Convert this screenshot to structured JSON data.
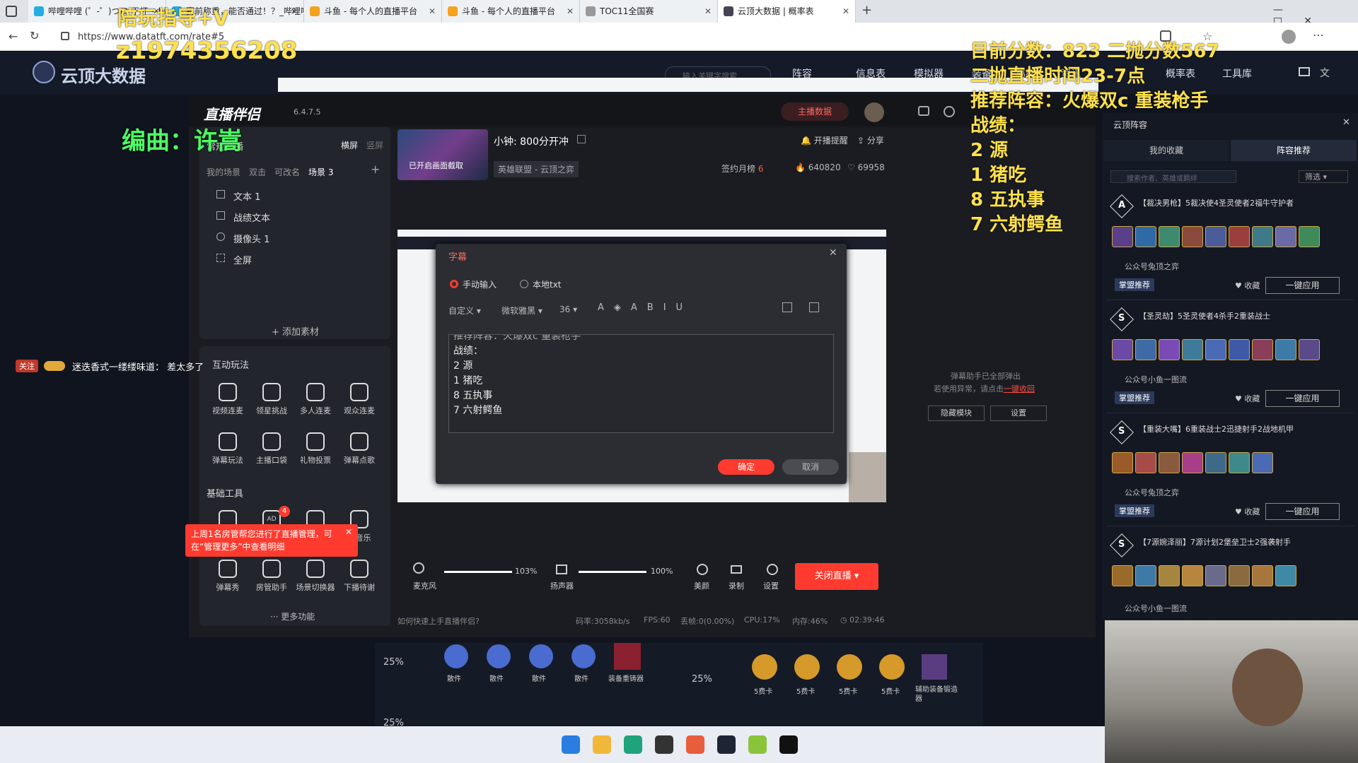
{
  "browser": {
    "tabs": [
      {
        "label": "哔哩哔哩 (゜-゜)つロ 干杯~-bili"
      },
      {
        "label": "赛前称重，能否通过！？_哔哩哔哩"
      },
      {
        "label": "斗鱼 - 每个人的直播平台"
      },
      {
        "label": "斗鱼 - 每个人的直播平台"
      },
      {
        "label": "TOC11全国赛"
      },
      {
        "label": "云顶大数据 | 概率表"
      }
    ],
    "url": "https://www.datatft.com/rate#5"
  },
  "site": {
    "logo": "云顶大数据",
    "search_placeholder": "输入关键字搜索",
    "nav": [
      "阵容",
      "信息表",
      "模拟器",
      "装备",
      "羁绊",
      "资讯",
      "概率表",
      "工具库"
    ]
  },
  "overlay": {
    "top_left_1": "陪玩指导+V",
    "top_left_2": "z1974356208",
    "composer": "编曲：许嵩",
    "right_lines": [
      "目前分数：823  二抛分数567",
      "二抛直播时间23-7点",
      "推荐阵容：火爆双c 重装枪手",
      "战绩：",
      "2 源",
      "1 猪吃",
      "8 五执事",
      "7 六射鳄鱼"
    ],
    "danmu_tag": "关注",
    "danmu_text": "迷迭香式一缕缕味道： 差太多了"
  },
  "app": {
    "name": "直播伴侣",
    "version": "6.4.7.5",
    "scene_title": "常规直播",
    "orient": [
      "横屏",
      "竖屏"
    ],
    "scene_tabs": [
      "我的场景",
      "双击",
      "可改名",
      "场景 3"
    ],
    "sources": [
      "文本 1",
      "战绩文本",
      "摄像头 1",
      "全屏"
    ],
    "add_material": "添加素材",
    "interactive_title": "互动玩法",
    "tools_row1": [
      "视频连麦",
      "领星挑战",
      "多人连麦",
      "观众连麦"
    ],
    "tools_row2": [
      "弹幕玩法",
      "主播口袋",
      "礼物投票",
      "弹幕点歌"
    ],
    "basic_title": "基础工具",
    "tools_row3": [
      "",
      "AD",
      "",
      "伴音乐"
    ],
    "tools_row4": [
      "弹幕秀",
      "房管助手",
      "场景切换器",
      "下播待谢"
    ],
    "badge": "4",
    "more": "更多功能",
    "toast": "上周1名房管帮您进行了直播管理，可在“管理更多”中查看明细",
    "main_data": "主播数据",
    "stream_title": "小钟: 800分开冲",
    "category": "英雄联盟 - 云顶之弈",
    "thumb_text": "已开启画面截取",
    "remind": "开播提醒",
    "share": "分享",
    "sign_label": "签约月榜",
    "sign_val": "6",
    "hot": "640820",
    "likes": "69958",
    "bullet_done": "弹幕助手已全部弹出",
    "bullet_hint": "若使用异常，请点击",
    "bullet_link": "一键收回",
    "hide_module": "隐藏模块",
    "settings": "设置",
    "mic_label": "麦克风",
    "mic_pct": "103%",
    "mic_level": 1.0,
    "speaker_label": "扬声器",
    "spk_pct": "100%",
    "spk_level": 1.0,
    "beauty": "美颜",
    "record": "录制",
    "set": "设置",
    "close_live": "关闭直播",
    "help": "如何快速上手直播伴侣?",
    "bitrate": "码率:3058kb/s",
    "fps": "FPS:60",
    "dropped": "丢帧:0(0.00%)",
    "cpu": "CPU:17%",
    "mem": "内存:46%",
    "time": "02:39:46"
  },
  "dialog": {
    "title": "字幕",
    "opt_manual": "手动输入",
    "opt_local": "本地txt",
    "font_custom": "自定义",
    "font": "微软雅黑",
    "size": "36",
    "lines": [
      "推荐阵容：火爆双c 重装枪手",
      "战绩：",
      "2 源",
      "1 猪吃",
      "8 五执事",
      "7 六射鳄鱼"
    ],
    "ok": "确定",
    "cancel": "取消"
  },
  "tft": {
    "title": "云顶阵容",
    "tab_fav": "我的收藏",
    "tab_rec": "阵容推荐",
    "search_placeholder": "搜索作者、英雄或羁绊",
    "filter": "筛选",
    "comps": [
      {
        "tier": "A",
        "name": "【裁决男枪】5裁决使4圣灵使者2福牛守护者",
        "author": "公众号兔顶之弈",
        "tag": "掌盟推荐",
        "fav": "收藏",
        "apply": "一键应用"
      },
      {
        "tier": "S",
        "name": "【圣灵劫】5圣灵使者4杀手2重装战士",
        "author": "公众号小鱼一图流",
        "tag": "掌盟推荐",
        "fav": "收藏",
        "apply": "一键应用"
      },
      {
        "tier": "S",
        "name": "【重装大嘴】6重装战士2迅捷射手2战地机甲",
        "author": "公众号兔顶之弈",
        "tag": "掌盟推荐",
        "fav": "收藏",
        "apply": "一键应用"
      },
      {
        "tier": "S",
        "name": "【7源婉泽丽】7源计划2堡垒卫士2强袭射手",
        "author": "公众号小鱼一图流",
        "tag": "",
        "fav": "",
        "apply": ""
      }
    ]
  },
  "table": {
    "pct1": "25%",
    "pct2": "25%",
    "pct3": "25%",
    "items_left": [
      "散件",
      "散件",
      "散件",
      "散件",
      "装备重铸器"
    ],
    "items_right": [
      "5费卡",
      "5费卡",
      "5费卡",
      "5费卡",
      "辅助装备锻造器"
    ]
  },
  "colors": {
    "accent": "#ff3b2f",
    "overlay": "#ffe14d",
    "overlay_green": "#4cff63"
  }
}
